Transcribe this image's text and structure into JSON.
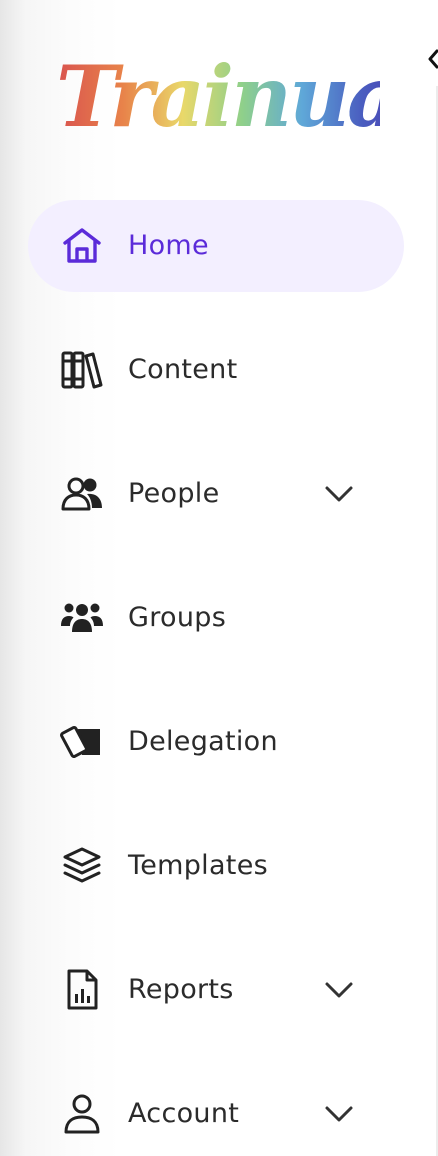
{
  "app": {
    "logo_text": "Trainual",
    "logo_icon": "trainual-rainbow-wordmark"
  },
  "colors": {
    "active_text": "#5b2bd9",
    "active_background": "#f3efff",
    "text": "#2b2b2b"
  },
  "sidebar": {
    "collapse_icon": "chevron-left-icon",
    "items": [
      {
        "label": "Home",
        "icon": "home-icon",
        "active": true,
        "has_chevron": false
      },
      {
        "label": "Content",
        "icon": "books-icon",
        "active": false,
        "has_chevron": false
      },
      {
        "label": "People",
        "icon": "people-icon",
        "active": false,
        "has_chevron": true
      },
      {
        "label": "Groups",
        "icon": "groups-icon",
        "active": false,
        "has_chevron": false
      },
      {
        "label": "Delegation",
        "icon": "delegation-cards-icon",
        "active": false,
        "has_chevron": false
      },
      {
        "label": "Templates",
        "icon": "layers-icon",
        "active": false,
        "has_chevron": false
      },
      {
        "label": "Reports",
        "icon": "report-chart-icon",
        "active": false,
        "has_chevron": true
      },
      {
        "label": "Account",
        "icon": "user-icon",
        "active": false,
        "has_chevron": true
      }
    ]
  }
}
